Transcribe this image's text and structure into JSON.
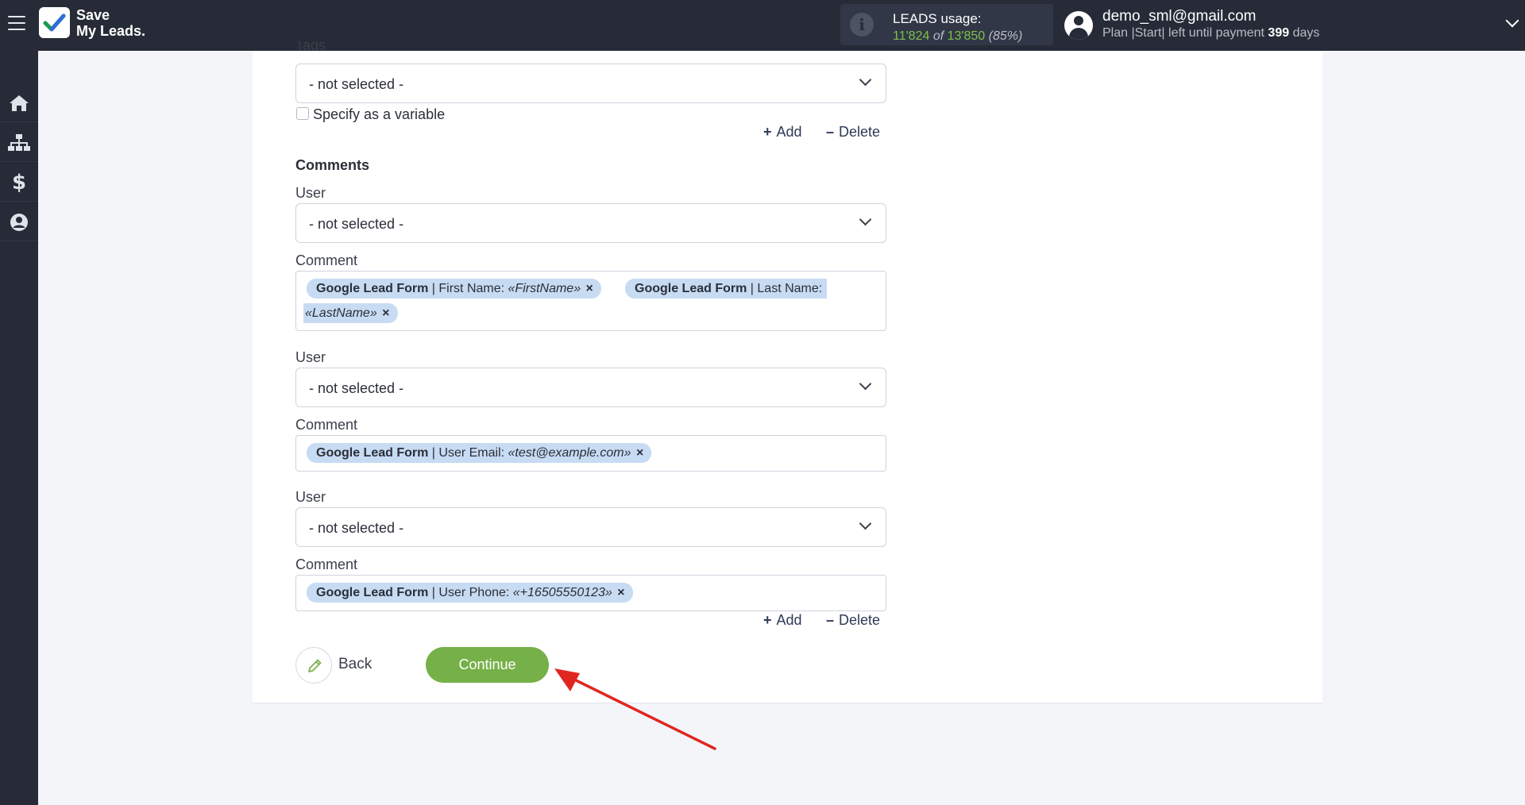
{
  "app": {
    "logo_line1": "Save",
    "logo_line2": "My Leads."
  },
  "usage": {
    "title": "LEADS usage:",
    "used": "11'824",
    "of": "of",
    "total": "13'850",
    "percent": "(85%)"
  },
  "user": {
    "email": "demo_sml@gmail.com",
    "plan_prefix": "Plan |Start| left until payment",
    "days": "399",
    "days_suffix": "days"
  },
  "sidebar": {
    "items": [
      "home-icon",
      "sitemap-icon",
      "dollar-icon",
      "user-circle-icon"
    ],
    "dollar_glyph": "$"
  },
  "tags_section": {
    "partial_label": "Tags",
    "select_value": "- not selected -",
    "variable_label": "Specify as a variable",
    "add_label": "Add",
    "delete_label": "Delete"
  },
  "comments": {
    "title": "Comments",
    "user_label": "User",
    "comment_label": "Comment",
    "user_placeholder": "- not selected -",
    "entries": [
      {
        "user_value": "- not selected -",
        "tags": [
          {
            "source": "Google Lead Form",
            "field": " | First Name: ",
            "value": "«FirstName»",
            "remove": "×"
          },
          {
            "source": "Google Lead Form",
            "field": " | Last Name:",
            "value": "«LastName»",
            "remove": "×"
          }
        ]
      },
      {
        "user_value": "- not selected -",
        "tags": [
          {
            "source": "Google Lead Form",
            "field": " | User Email: ",
            "value": "«test@example.com»",
            "remove": "×"
          }
        ]
      },
      {
        "user_value": "- not selected -",
        "tags": [
          {
            "source": "Google Lead Form",
            "field": " | User Phone: ",
            "value": "«+16505550123»",
            "remove": "×"
          }
        ]
      }
    ],
    "add_label": "Add",
    "delete_label": "Delete",
    "add_symbol": "+",
    "delete_symbol": "–"
  },
  "footer": {
    "back_label": "Back",
    "continue_label": "Continue"
  },
  "colors": {
    "accent_green": "#75b048",
    "topbar_bg": "#262b37",
    "tag_bg": "#c7dbf3",
    "arrow_red": "#e0261f"
  }
}
